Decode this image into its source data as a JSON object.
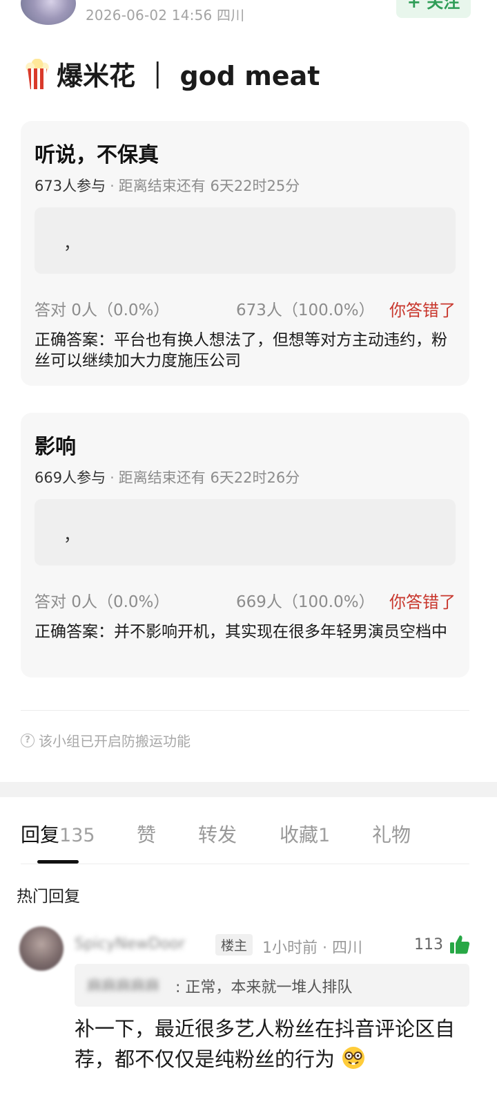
{
  "header": {
    "meta": "2026-06-02 14:56  四川",
    "follow_label": "+ 关注"
  },
  "post": {
    "title": "爆米花 ｜ god meat"
  },
  "polls": [
    {
      "title": "听说，不保真",
      "participants": "673人参与",
      "time_left": "距离结束还有 6天22时25分",
      "option_text": "，",
      "correct_stat": "答对  0人（0.0%）",
      "wrong_stat": "673人（100.0%）",
      "result": "你答错了",
      "answer": "正确答案：平台也有换人想法了，但想等对方主动违约，粉丝可以继续加大力度施压公司"
    },
    {
      "title": "影响",
      "participants": "669人参与",
      "time_left": "距离结束还有 6天22时26分",
      "option_text": "，",
      "correct_stat": "答对  0人（0.0%）",
      "wrong_stat": "669人（100.0%）",
      "result": "你答错了",
      "answer": "正确答案：并不影响开机，其实现在很多年轻男演员空档中"
    }
  ],
  "notice": "该小组已开启防搬运功能",
  "tabs": [
    {
      "label": "回复",
      "count": "135"
    },
    {
      "label": "赞",
      "count": ""
    },
    {
      "label": "转发",
      "count": ""
    },
    {
      "label": "收藏",
      "count": "1"
    },
    {
      "label": "礼物",
      "count": ""
    }
  ],
  "hot_label": "热门回复",
  "comment": {
    "username": "SpicyNewDoor",
    "badge": "楼主",
    "time": "1小时前 · 四川",
    "likes": "113",
    "quote_user": "麻麻麻麻麻",
    "quote_text": ": 正常，本来就一堆人排队",
    "body": "补一下，最近很多艺人粉丝在抖音评论区自荐，都不仅仅是纯粉丝的行为",
    "icons": {
      "like": "thumbs-up-icon",
      "emoji": "nerd-face-emoji"
    }
  },
  "colors": {
    "accent_green": "#2f9d57",
    "wrong_red": "#c8372d"
  }
}
